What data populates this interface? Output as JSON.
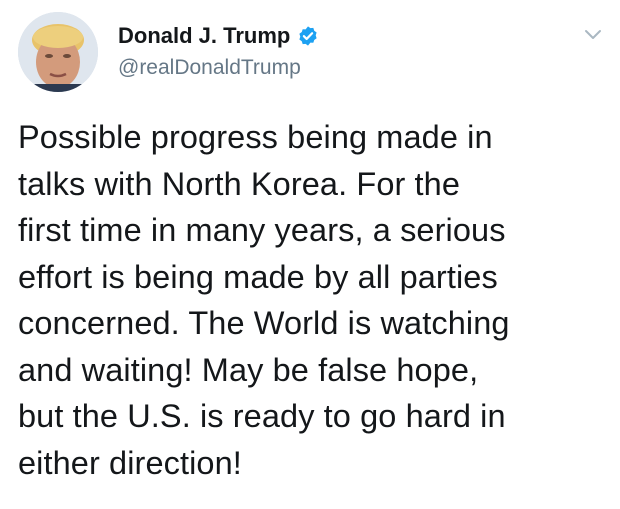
{
  "user": {
    "display_name": "Donald J. Trump",
    "handle": "@realDonaldTrump",
    "verified": true,
    "avatar_icon": "profile-photo"
  },
  "tweet": {
    "lines": [
      "Possible progress being made in",
      "talks with North Korea. For the",
      "first time in many years, a serious",
      "effort is being made by all parties",
      "concerned. The World is watching",
      "and waiting! May be false hope,",
      "but the U.S. is ready to go hard in",
      "either direction!"
    ]
  },
  "icons": {
    "verified": "verified-badge-icon",
    "menu": "chevron-down-icon"
  },
  "colors": {
    "verified_blue": "#1da1f2",
    "handle_gray": "#657786",
    "text": "#14171a",
    "caret_gray": "#aab8c2"
  }
}
